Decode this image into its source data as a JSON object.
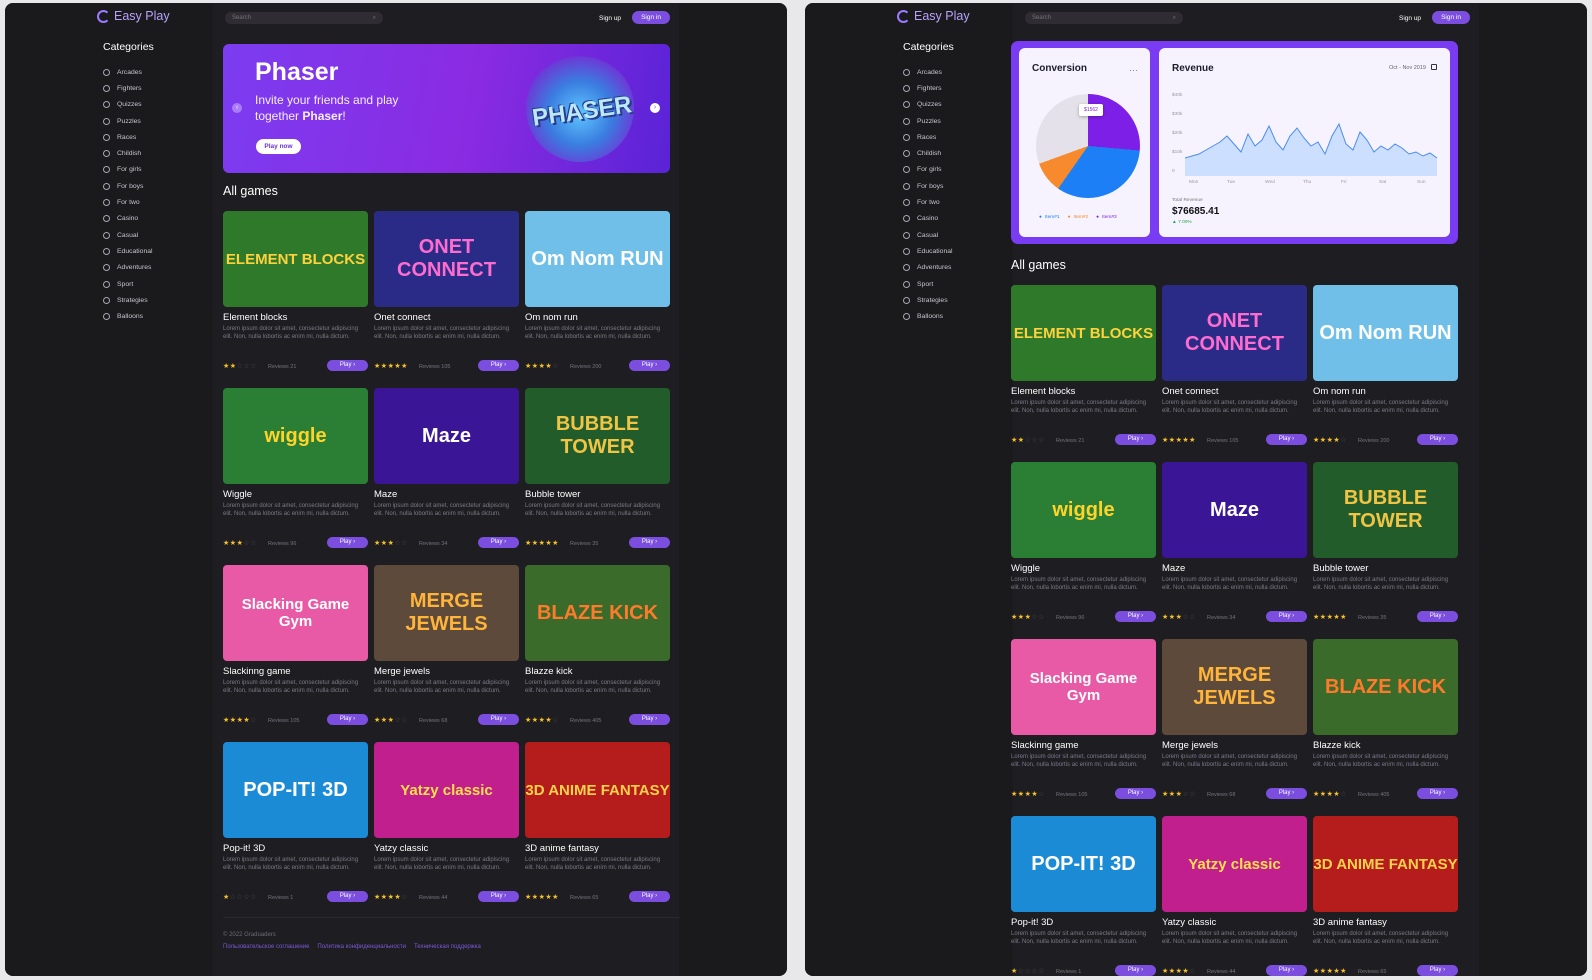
{
  "header": {
    "logo": "Easy Play",
    "search_placeholder": "Search",
    "signup": "Sign up",
    "signin": "Sign in"
  },
  "sidebar": {
    "title": "Categories",
    "items": [
      "Arcades",
      "Fighters",
      "Quizzes",
      "Puzzles",
      "Races",
      "Childish",
      "For girls",
      "For boys",
      "For two",
      "Casino",
      "Casual",
      "Educational",
      "Adventures",
      "Sport",
      "Strategies",
      "Balloons"
    ]
  },
  "banner": {
    "title": "Phaser",
    "text_a": "Invite your friends and play together ",
    "text_b": "Phaser",
    "text_c": "!",
    "button": "Play now",
    "art_text": "PHASER"
  },
  "dashboard": {
    "conversion_title": "Conversion",
    "revenue_title": "Revenue",
    "date_range": "Oct - Nov 2019",
    "pie_tooltip": "$1562",
    "legend": [
      "Item#1",
      "Item#2",
      "Item#3"
    ],
    "y_ticks": [
      "$40k",
      "$30k",
      "$20k",
      "$10k",
      "0"
    ],
    "x_ticks": [
      "Mon",
      "Tue",
      "Wed",
      "Thu",
      "Fri",
      "Sat",
      "Sun"
    ],
    "total_label": "Total Revenue",
    "total_value": "$76685.41",
    "change": "▲ 7.00%"
  },
  "section_title": "All games",
  "games": [
    {
      "name": "Element blocks",
      "stars": 2,
      "reviews": "Reviews 21",
      "art": "ELEMENT BLOCKS",
      "bg": "#2f7a2a",
      "fg": "#ffd23d"
    },
    {
      "name": "Onet connect",
      "stars": 5,
      "reviews": "Reviews 105",
      "art": "ONET CONNECT",
      "bg": "#2a2b86",
      "fg": "#ff6ccf"
    },
    {
      "name": "Om nom run",
      "stars": 4,
      "reviews": "Reviews 200",
      "art": "Om Nom RUN",
      "bg": "#6fbfe8",
      "fg": "#ffffff"
    },
    {
      "name": "Wiggle",
      "stars": 3,
      "reviews": "Reviews 96",
      "art": "wiggle",
      "bg": "#2a7f35",
      "fg": "#ffd42a"
    },
    {
      "name": "Maze",
      "stars": 3,
      "reviews": "Reviews 34",
      "art": "Maze",
      "bg": "#3a1595",
      "fg": "#ffffff"
    },
    {
      "name": "Bubble tower",
      "stars": 5,
      "reviews": "Reviews 35",
      "art": "BUBBLE TOWER",
      "bg": "#235c2b",
      "fg": "#f0c545"
    },
    {
      "name": "Slackinng game",
      "stars": 4,
      "reviews": "Reviews 105",
      "art": "Slacking Game Gym",
      "bg": "#e95aa6",
      "fg": "#ffffff"
    },
    {
      "name": "Merge jewels",
      "stars": 3,
      "reviews": "Reviews 68",
      "art": "MERGE JEWELS",
      "bg": "#5e4a3a",
      "fg": "#ffb43a"
    },
    {
      "name": "Blazze kick",
      "stars": 4,
      "reviews": "Reviews 405",
      "art": "BLAZE KICK",
      "bg": "#3b6b2b",
      "fg": "#ff7a2a"
    },
    {
      "name": "Pop-it! 3D",
      "stars": 1,
      "reviews": "Reviews 1",
      "art": "POP-IT! 3D",
      "bg": "#1b8bd6",
      "fg": "#ffffff"
    },
    {
      "name": "Yatzy classic",
      "stars": 4,
      "reviews": "Reviews 44",
      "art": "Yatzy classic",
      "bg": "#c11f8d",
      "fg": "#ffe04a"
    },
    {
      "name": "3D anime fantasy",
      "stars": 5,
      "reviews": "Reviews 65",
      "art": "3D ANIME FANTASY",
      "bg": "#b51d1d",
      "fg": "#ffd24a"
    }
  ],
  "game_desc": "Lorem ipsum dolor sit amet, consectetur adipiscing elit. Non, nulla lobortis ac enim mi, nulla dictum.",
  "play_label": "Play ›",
  "footer": {
    "copyright": "© 2022 Graduaders",
    "links": [
      "Пользовательское соглашение",
      "Политика конфиденциальности",
      "Техническая поддержка"
    ]
  },
  "colors": {
    "accent": "#7b4ee0",
    "bg": "#1a191c",
    "star": "#f6c02a"
  },
  "chart_data": {
    "type": "pie",
    "title": "Conversion",
    "categories": [
      "Item#1",
      "Item#2",
      "Item#3"
    ],
    "tooltip": "$1562"
  }
}
